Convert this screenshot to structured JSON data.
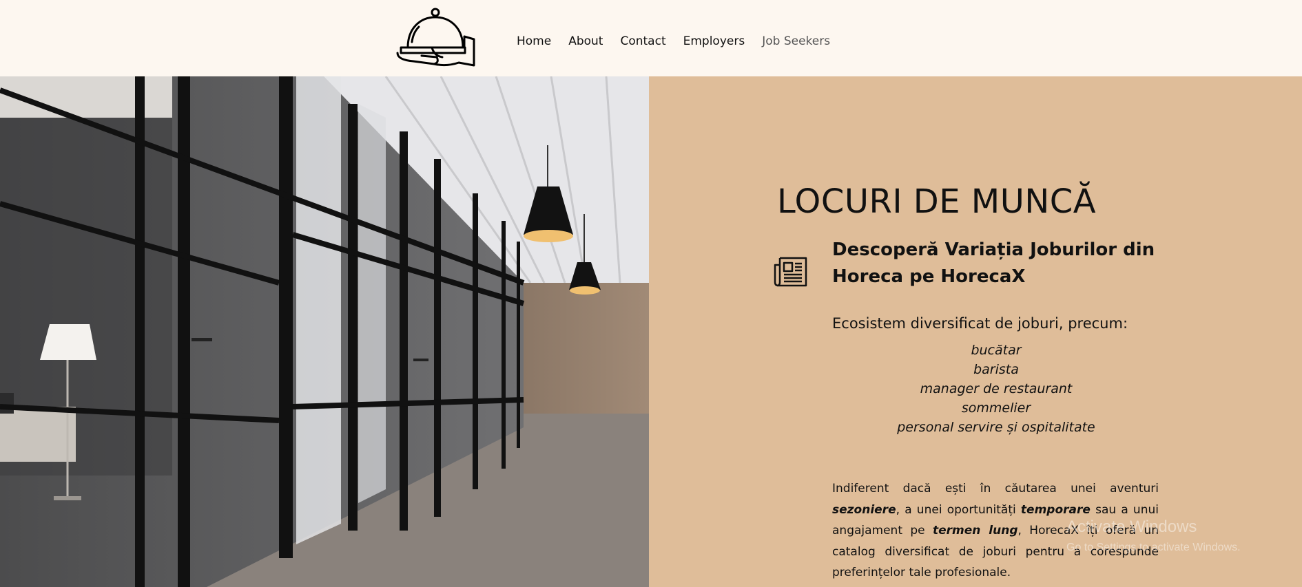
{
  "nav": {
    "items": [
      "Home",
      "About",
      "Contact",
      "Employers",
      "Job Seekers"
    ]
  },
  "icons": {
    "logo": "cloche-hand-logo",
    "section": "newspaper-icon"
  },
  "hero": {
    "title": "LOCURI DE MUNCĂ",
    "subtitle": "Descoperă Variația Joburilor din Horeca pe HorecaX",
    "intro": "Ecosistem diversificat de joburi, precum:",
    "jobs": [
      "bucătar",
      "barista",
      "manager de restaurant",
      "sommelier",
      "personal servire și ospitalitate"
    ],
    "paragraph": {
      "p1": "Indiferent dacă ești în căutarea unei aventuri ",
      "b1": "sezoniere",
      "p2": ", a unei oportunități ",
      "b2": "temporare",
      "p3": " sau a unui angajament pe ",
      "b3": "termen lung",
      "p4": ", HorecaX îți oferă un catalog diversificat de joburi pentru a corespunde preferințelor tale profesionale."
    }
  },
  "watermark": {
    "line1": "Activate Windows",
    "line2": "Go to Settings to activate Windows."
  },
  "colors": {
    "header_bg": "#fdf7f0",
    "panel_bg": "#dfbd99",
    "text": "#111111"
  }
}
